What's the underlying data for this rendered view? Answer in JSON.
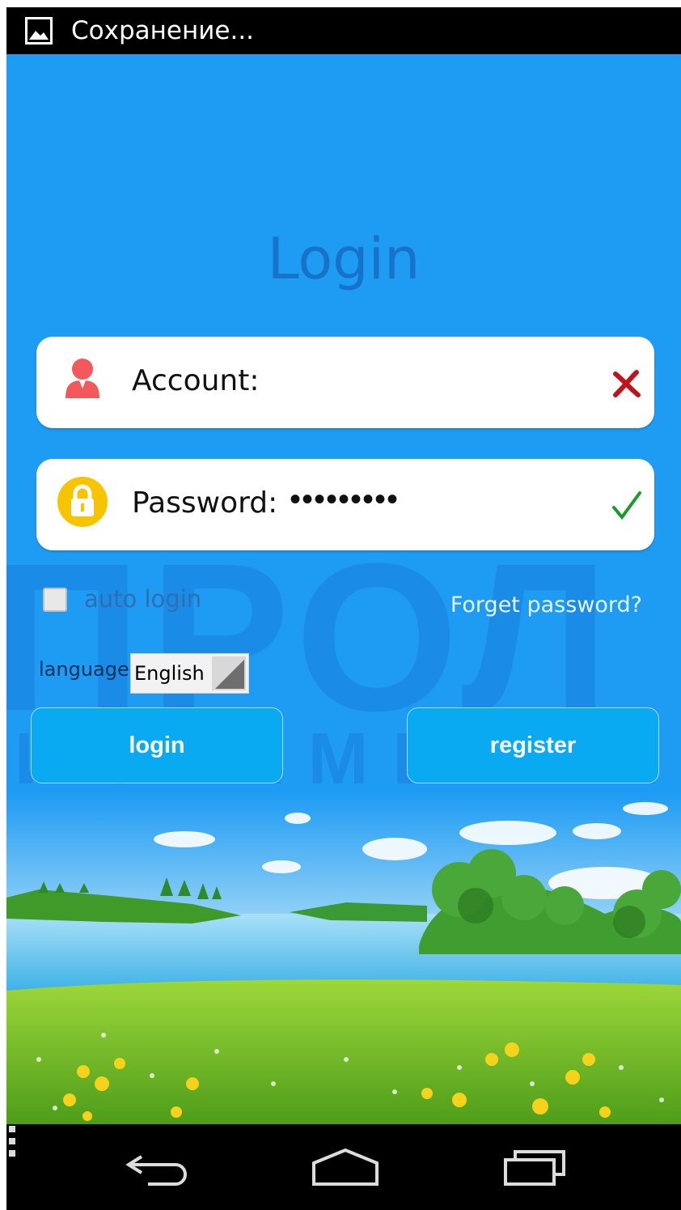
{
  "status_bar": {
    "text": "Сохранение..."
  },
  "title": "Login",
  "watermark": {
    "main": "ПРОЛ",
    "sub": "ИСТЕМЫ БЕЗО"
  },
  "account": {
    "label": "Account:",
    "value": "",
    "status": "invalid",
    "status_color": "#c0141c"
  },
  "password": {
    "label": "Password:",
    "value": "•••••••••",
    "status": "valid",
    "status_color": "#1a9a2a"
  },
  "auto_login": {
    "label": "auto login",
    "checked": false
  },
  "forget_password": "Forget password?",
  "language": {
    "label": "language:",
    "selected": "English"
  },
  "buttons": {
    "login": "login",
    "register": "register"
  },
  "icons": [
    "gallery-icon",
    "user-icon",
    "lock-icon",
    "error-x-icon",
    "checkmark-icon",
    "dropdown-arrow-icon",
    "back-icon",
    "home-icon",
    "recents-icon",
    "menu-icon"
  ],
  "colors": {
    "background": "#1e9bf3",
    "title": "#1773c7",
    "button": "#0aaaf2",
    "user_icon": "#f2585c",
    "lock_icon": "#f7c400"
  }
}
